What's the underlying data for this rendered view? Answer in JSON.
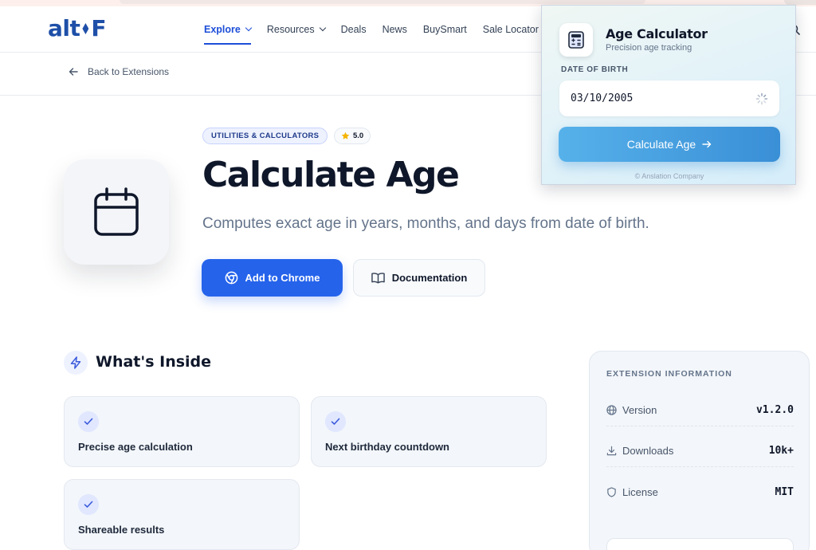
{
  "header": {
    "logo_left": "alt",
    "logo_right": "F",
    "nav": [
      {
        "label": "Explore",
        "active": true,
        "dropdown": true
      },
      {
        "label": "Resources",
        "active": false,
        "dropdown": true
      },
      {
        "label": "Deals",
        "active": false,
        "dropdown": false
      },
      {
        "label": "News",
        "active": false,
        "dropdown": false
      },
      {
        "label": "BuySmart",
        "active": false,
        "dropdown": false
      },
      {
        "label": "Sale Locator",
        "active": false,
        "dropdown": false
      }
    ]
  },
  "back": {
    "label": "Back to Extensions"
  },
  "hero": {
    "category": "UTILITIES & CALCULATORS",
    "rating": "5.0",
    "title": "Calculate Age",
    "description": "Computes exact age in years, months, and days from date of birth.",
    "primary_button": "Add to Chrome",
    "secondary_button": "Documentation"
  },
  "features": {
    "title": "What's Inside",
    "items": [
      "Precise age calculation",
      "Next birthday countdown",
      "Shareable results"
    ]
  },
  "info": {
    "title": "EXTENSION INFORMATION",
    "rows": [
      {
        "key": "Version",
        "value": "v1.2.0",
        "icon": "globe-icon"
      },
      {
        "key": "Downloads",
        "value": "10k+",
        "icon": "download-icon"
      },
      {
        "key": "License",
        "value": "MIT",
        "icon": "shield-icon"
      }
    ]
  },
  "popup": {
    "title": "Age Calculator",
    "subtitle": "Precision age tracking",
    "dob_label": "DATE OF BIRTH",
    "dob_value": "03/10/2005",
    "button": "Calculate Age",
    "footer": "© Anslation Company"
  },
  "colors": {
    "accent": "#2563eb",
    "logo": "#1e4fa8",
    "popup_button": "#3a8fd6"
  }
}
